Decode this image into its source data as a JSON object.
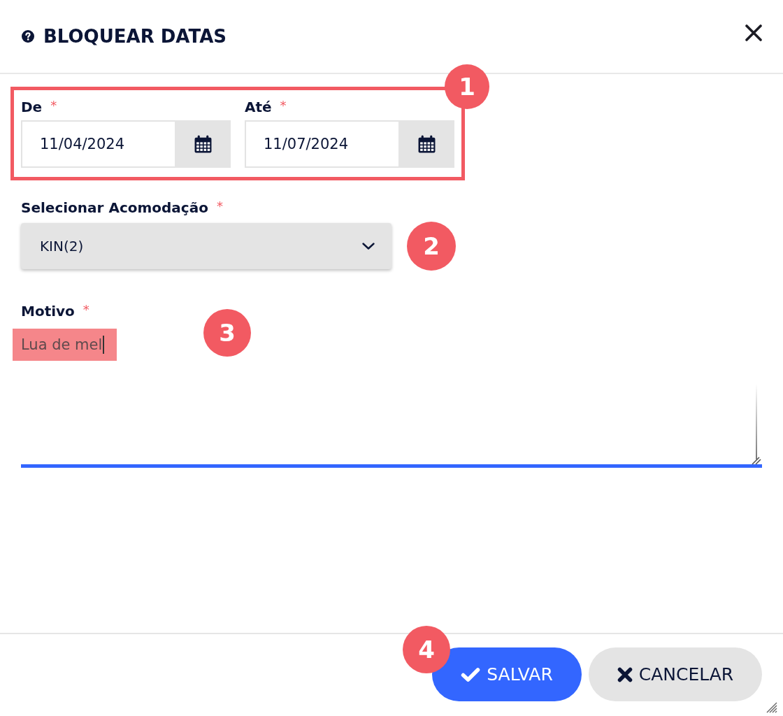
{
  "dialog": {
    "title": "BLOQUEAR DATAS"
  },
  "date_range": {
    "framed": true,
    "callout": "1",
    "fields": [
      {
        "label": "De",
        "required_mark": "*",
        "value": "11/04/2024"
      },
      {
        "label": "Até",
        "required_mark": "*",
        "value": "11/07/2024"
      }
    ]
  },
  "accommodation": {
    "label": "Selecionar Acomodação",
    "required_mark": "*",
    "value": "KIN(2)",
    "callout": "2"
  },
  "reason": {
    "label": "Motivo",
    "required_mark": "*",
    "value": "Lua de mel",
    "focused": true,
    "highlighted": true,
    "callout": "3"
  },
  "footer": {
    "callout": "4",
    "buttons": [
      {
        "kind": "primary",
        "label": "SALVAR"
      },
      {
        "kind": "secondary",
        "label": "CANCELAR"
      }
    ]
  }
}
